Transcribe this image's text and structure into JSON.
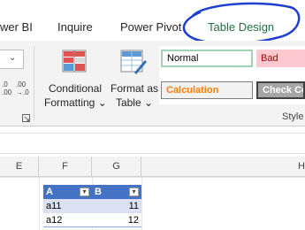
{
  "ribbon_tabs": {
    "power_bi": "wer BI",
    "inquire": "Inquire",
    "power_pivot": "Power Pivot",
    "table_design": "Table Design"
  },
  "ribbon": {
    "conditional_formatting_line1": "Conditional",
    "conditional_formatting_line2": "Formatting",
    "format_as_table_line1": "Format as",
    "format_as_table_line2": "Table",
    "number_format_increase": ".0\n.00",
    "number_format_decrease": ".00\n→.0",
    "styles_group_label": "Style"
  },
  "cell_styles": {
    "normal": "Normal",
    "bad": "Bad",
    "calculation": "Calculation",
    "check_cell": "Check Cell"
  },
  "grid": {
    "columns": [
      "E",
      "F",
      "G",
      "H"
    ],
    "table_header_a": "A",
    "table_header_b": "B",
    "rows": [
      {
        "a": "a11",
        "b": "11"
      },
      {
        "a": "a12",
        "b": "12"
      }
    ]
  },
  "colors": {
    "accent_annotation": "#1f3fd1",
    "table_header": "#4472c4",
    "table_band": "#d9e1f2",
    "good_border": "#9fd3b5",
    "bad_fill": "#ffc7ce",
    "calc_text": "#fa7d00"
  }
}
